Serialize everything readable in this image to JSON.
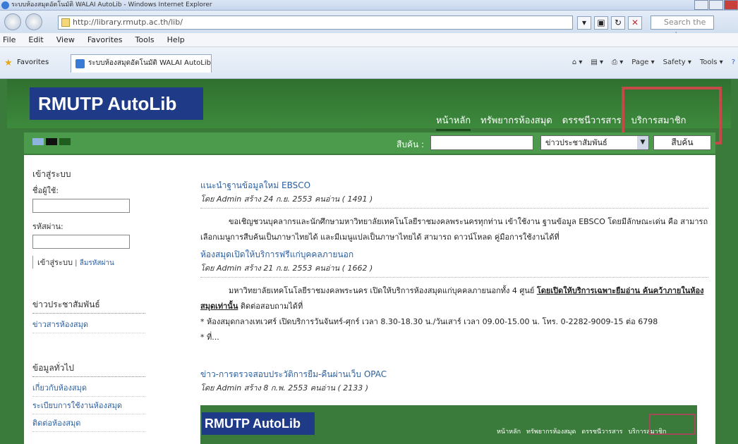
{
  "browser": {
    "window_title": "ระบบห้องสมุดอัตโนมัติ WALAI AutoLib - Windows Internet Explorer",
    "url": "http://library.rmutp.ac.th/lib/",
    "search_placeholder": "Search the web",
    "menu": [
      "File",
      "Edit",
      "View",
      "Favorites",
      "Tools",
      "Help"
    ],
    "favorites_label": "Favorites",
    "tab_title": "ระบบห้องสมุดอัตโนมัติ WALAI AutoLib",
    "command_bar": [
      "Page ▾",
      "Safety ▾",
      "Tools ▾"
    ]
  },
  "site": {
    "logo": "RMUTP AutoLib",
    "nav": [
      "หน้าหลัก",
      "ทรัพยากรห้องสมุด",
      "ดรรชนีวารสาร",
      "บริการสมาชิก"
    ],
    "search_label": "สืบค้น :",
    "search_select": "ข่าวประชาสัมพันธ์",
    "search_button": "สืบค้น"
  },
  "sidebar": {
    "login_title": "เข้าสู่ระบบ",
    "username_label": "ชื่อผู้ใช้:",
    "password_label": "รหัสผ่าน:",
    "login_link": "เข้าสู่ระบบ",
    "forgot_link": "ลืมรหัสผ่าน",
    "news_title": "ข่าวประชาสัมพันธ์",
    "news_links": [
      "ข่าวสารห้องสมุด"
    ],
    "info_title": "ข้อมูลทั่วไป",
    "info_links": [
      "เกี่ยวกับห้องสมุด",
      "ระเบียบการใช้งานห้องสมุด",
      "ติดต่อห้องสมุด"
    ]
  },
  "articles": [
    {
      "title": "แนะนำฐานข้อมูลใหม่ EBSCO",
      "meta": "โดย Admin สร้าง 24 ก.ย. 2553 คนอ่าน ( 1491 )",
      "body": "ขอเชิญชวนบุคลากรและนักศึกษามหาวิทยาลัยเทคโนโลยีราชมงคลพระนครทุกท่าน เข้าใช้งาน ฐานข้อมูล EBSCO โดยมีลักษณะเด่น คือ สามารถเลือกเมนูการสืบค้นเป็นภาษาไทยได้ และมีเมนูแปลเป็นภาษาไทยได้ สามารถ ดาวน์โหลด คู่มือการใช้งานได้ที่"
    },
    {
      "title": "ห้องสมุดเปิดให้บริการฟรีแก่บุคคลภายนอก",
      "meta": "โดย Admin สร้าง 21 ก.ย. 2553 คนอ่าน ( 1662 )",
      "body1": "มหาวิทยาลัยเทคโนโลยีราชมงคลพระนคร เปิดให้บริการห้องสมุดแก่บุคคลภายนอกทั้ง 4 ศูนย์",
      "body1_ul": "โดยเปิดให้บริการเฉพาะยืมอ่าน ค้นคว้าภายในห้องสมุดเท่านั้น",
      "body1_tail": "ติดต่อสอบถามได้ที่",
      "body2": "* ห้องสมุดกลางเทเวศร์ เปิดบริการวันจันทร์-ศุกร์ เวลา 8.30-18.30 น./วันเสาร์ เวลา 09.00-15.00 น. โทร. 0-2282-9009-15 ต่อ 6798",
      "body3": "* ที่..."
    },
    {
      "title": "ข่าว-การตรวจสอบประวัติการยืม-คืนผ่านเว็บ OPAC",
      "meta": "โดย Admin สร้าง 8 ก.พ. 2553 คนอ่าน ( 2133 )"
    }
  ],
  "embedded": {
    "logo": "RMUTP AutoLib",
    "nav": [
      "หน้าหลัก",
      "ทรัพยากรห้องสมุด",
      "ดรรชนีวารสาร",
      "บริการสมาชิก"
    ]
  }
}
